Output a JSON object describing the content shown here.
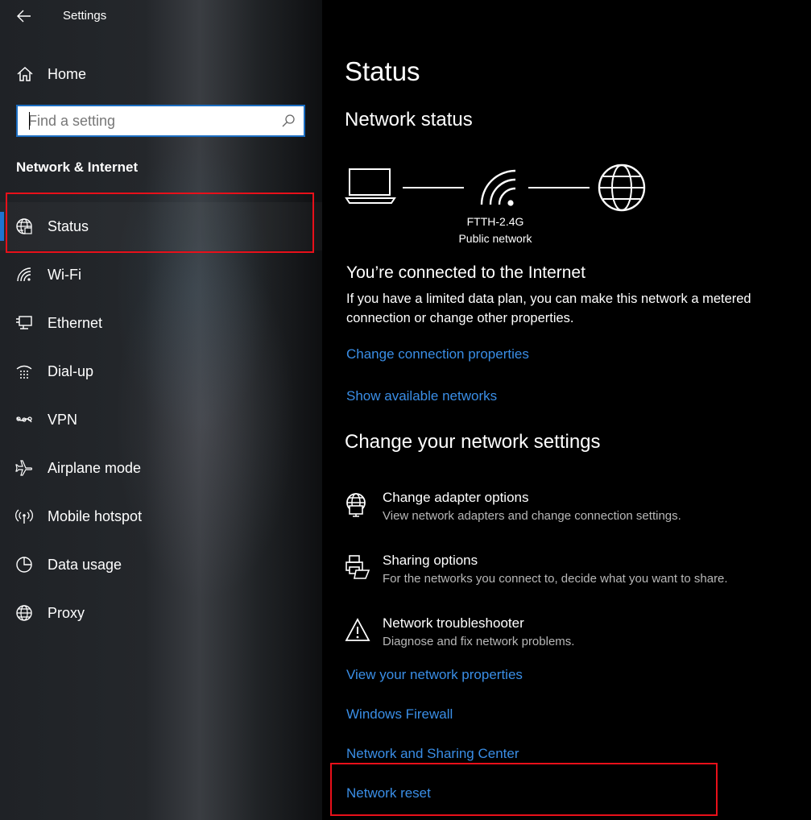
{
  "app": {
    "title": "Settings"
  },
  "sidebar": {
    "home_label": "Home",
    "search_placeholder": "Find a setting",
    "section_title": "Network & Internet",
    "items": [
      {
        "label": "Status",
        "icon": "globe-status-icon",
        "selected": true
      },
      {
        "label": "Wi-Fi",
        "icon": "wifi-icon"
      },
      {
        "label": "Ethernet",
        "icon": "ethernet-icon"
      },
      {
        "label": "Dial-up",
        "icon": "dialup-icon"
      },
      {
        "label": "VPN",
        "icon": "vpn-icon"
      },
      {
        "label": "Airplane mode",
        "icon": "airplane-icon"
      },
      {
        "label": "Mobile hotspot",
        "icon": "hotspot-icon"
      },
      {
        "label": "Data usage",
        "icon": "data-usage-icon"
      },
      {
        "label": "Proxy",
        "icon": "globe-icon"
      }
    ]
  },
  "main": {
    "title": "Status",
    "network_status_heading": "Network status",
    "network": {
      "name": "FTTH-2.4G",
      "type": "Public network"
    },
    "connected_title": "You’re connected to the Internet",
    "connected_desc": "If you have a limited data plan, you can make this network a metered connection or change other properties.",
    "links_top": [
      "Change connection properties",
      "Show available networks"
    ],
    "change_heading": "Change your network settings",
    "options": [
      {
        "title": "Change adapter options",
        "desc": "View network adapters and change connection settings.",
        "icon": "adapter-icon"
      },
      {
        "title": "Sharing options",
        "desc": "For the networks you connect to, decide what you want to share.",
        "icon": "sharing-icon"
      },
      {
        "title": "Network troubleshooter",
        "desc": "Diagnose and fix network problems.",
        "icon": "warning-icon"
      }
    ],
    "links_bottom": [
      "View your network properties",
      "Windows Firewall",
      "Network and Sharing Center",
      "Network reset"
    ]
  },
  "colors": {
    "accent": "#1f74d1",
    "link": "#3a8ee6",
    "highlight": "#e8101a",
    "search_border": "#1c6ec2"
  }
}
